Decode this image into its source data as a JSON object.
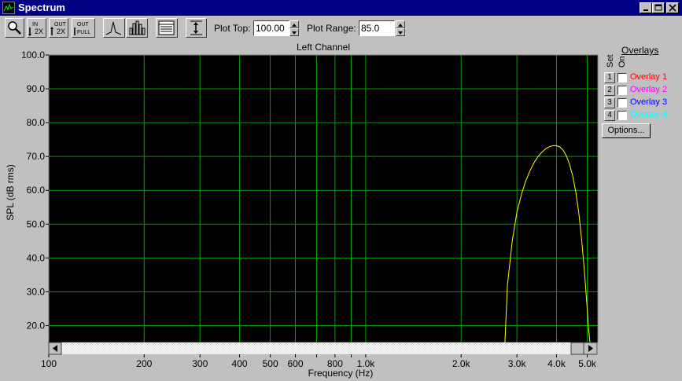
{
  "window": {
    "title": "Spectrum"
  },
  "toolbar": {
    "buttons": [
      {
        "name": "zoom-button",
        "icon": "magnifier-icon"
      },
      {
        "name": "zoom-in-2x-button",
        "icon": "zoom-in-2x-icon",
        "line1": "IN",
        "line2": "2X"
      },
      {
        "name": "zoom-out-2x-button",
        "icon": "zoom-out-2x-icon",
        "line1": "OUT",
        "line2": "2X"
      },
      {
        "name": "zoom-out-full-button",
        "icon": "zoom-out-full-icon",
        "line1": "OUT",
        "line2": "FULL"
      },
      {
        "name": "line-mode-button",
        "icon": "line-spectrum-icon"
      },
      {
        "name": "bar-mode-button",
        "icon": "bar-spectrum-icon"
      },
      {
        "name": "table-view-button",
        "icon": "table-icon"
      },
      {
        "name": "autoscale-button",
        "icon": "vertical-arrows-icon"
      }
    ],
    "plot_top_label": "Plot Top:",
    "plot_top_value": "100.00",
    "plot_range_label": "Plot Range:",
    "plot_range_value": "85.0"
  },
  "overlays": {
    "title": "Overlays",
    "set_label": "Set",
    "on_label": "On",
    "items": [
      {
        "num": "1",
        "label": "Overlay 1",
        "color": "#ff0000"
      },
      {
        "num": "2",
        "label": "Overlay 2",
        "color": "#ff00ff"
      },
      {
        "num": "3",
        "label": "Overlay 3",
        "color": "#0000ff"
      },
      {
        "num": "4",
        "label": "Overlay 4",
        "color": "#00ffff"
      }
    ],
    "options_label": "Options..."
  },
  "chart_data": {
    "type": "line",
    "title": "Left Channel",
    "xlabel": "Frequency (Hz)",
    "ylabel": "SPL (dB rms)",
    "xscale": "log",
    "xlim": [
      100,
      5400
    ],
    "ylim": [
      15,
      100
    ],
    "grid": true,
    "background": "#000000",
    "grid_color": "#00a000",
    "line_color": "#ffff00",
    "y_ticks": [
      {
        "v": 100,
        "label": "100.0"
      },
      {
        "v": 90,
        "label": "90.0"
      },
      {
        "v": 80,
        "label": "80.0"
      },
      {
        "v": 70,
        "label": "70.0"
      },
      {
        "v": 60,
        "label": "60.0"
      },
      {
        "v": 50,
        "label": "50.0"
      },
      {
        "v": 40,
        "label": "40.0"
      },
      {
        "v": 30,
        "label": "30.0"
      },
      {
        "v": 20,
        "label": "20.0"
      }
    ],
    "x_ticks": [
      {
        "v": 100,
        "label": "100"
      },
      {
        "v": 200,
        "label": "200"
      },
      {
        "v": 300,
        "label": "300"
      },
      {
        "v": 400,
        "label": "400"
      },
      {
        "v": 500,
        "label": "500"
      },
      {
        "v": 600,
        "label": "600"
      },
      {
        "v": 800,
        "label": "800"
      },
      {
        "v": 1000,
        "label": "1.0k"
      },
      {
        "v": 2000,
        "label": "2.0k"
      },
      {
        "v": 3000,
        "label": "3.0k"
      },
      {
        "v": 4000,
        "label": "4.0k"
      },
      {
        "v": 5000,
        "label": "5.0k"
      }
    ],
    "x_minor": [
      700,
      900
    ],
    "series": [
      {
        "x": [
          2750,
          2800,
          2900,
          3000,
          3100,
          3200,
          3300,
          3400,
          3500,
          3600,
          3700,
          3800,
          3900,
          4000,
          4100,
          4200,
          4300,
          4400,
          4500,
          4600,
          4700,
          4800,
          4900,
          5000,
          5050,
          5100
        ],
        "y": [
          15,
          32,
          45,
          53.5,
          58.8,
          62.8,
          65.8,
          68.2,
          70,
          71.3,
          72.3,
          72.9,
          73.2,
          73.2,
          72.8,
          71.8,
          70.1,
          67.6,
          64.2,
          59.6,
          53.5,
          45.5,
          36,
          25,
          19,
          15
        ]
      }
    ]
  }
}
